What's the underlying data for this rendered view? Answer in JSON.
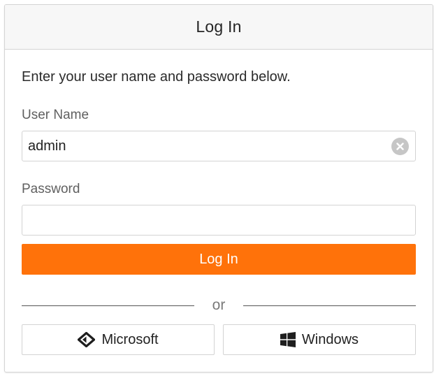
{
  "header": {
    "title": "Log In"
  },
  "form": {
    "intro": "Enter your user name and password below.",
    "username": {
      "label": "User Name",
      "value": "admin",
      "clear_icon": "clear-circle-icon"
    },
    "password": {
      "label": "Password",
      "value": ""
    },
    "submit_label": "Log In"
  },
  "alternatives": {
    "separator": "or",
    "microsoft": {
      "label": "Microsoft",
      "icon": "microsoft-logo-icon"
    },
    "windows": {
      "label": "Windows",
      "icon": "windows-logo-icon"
    }
  },
  "colors": {
    "accent": "#ff720a",
    "header_bg": "#f7f7f7",
    "border": "#d3d3d3"
  }
}
